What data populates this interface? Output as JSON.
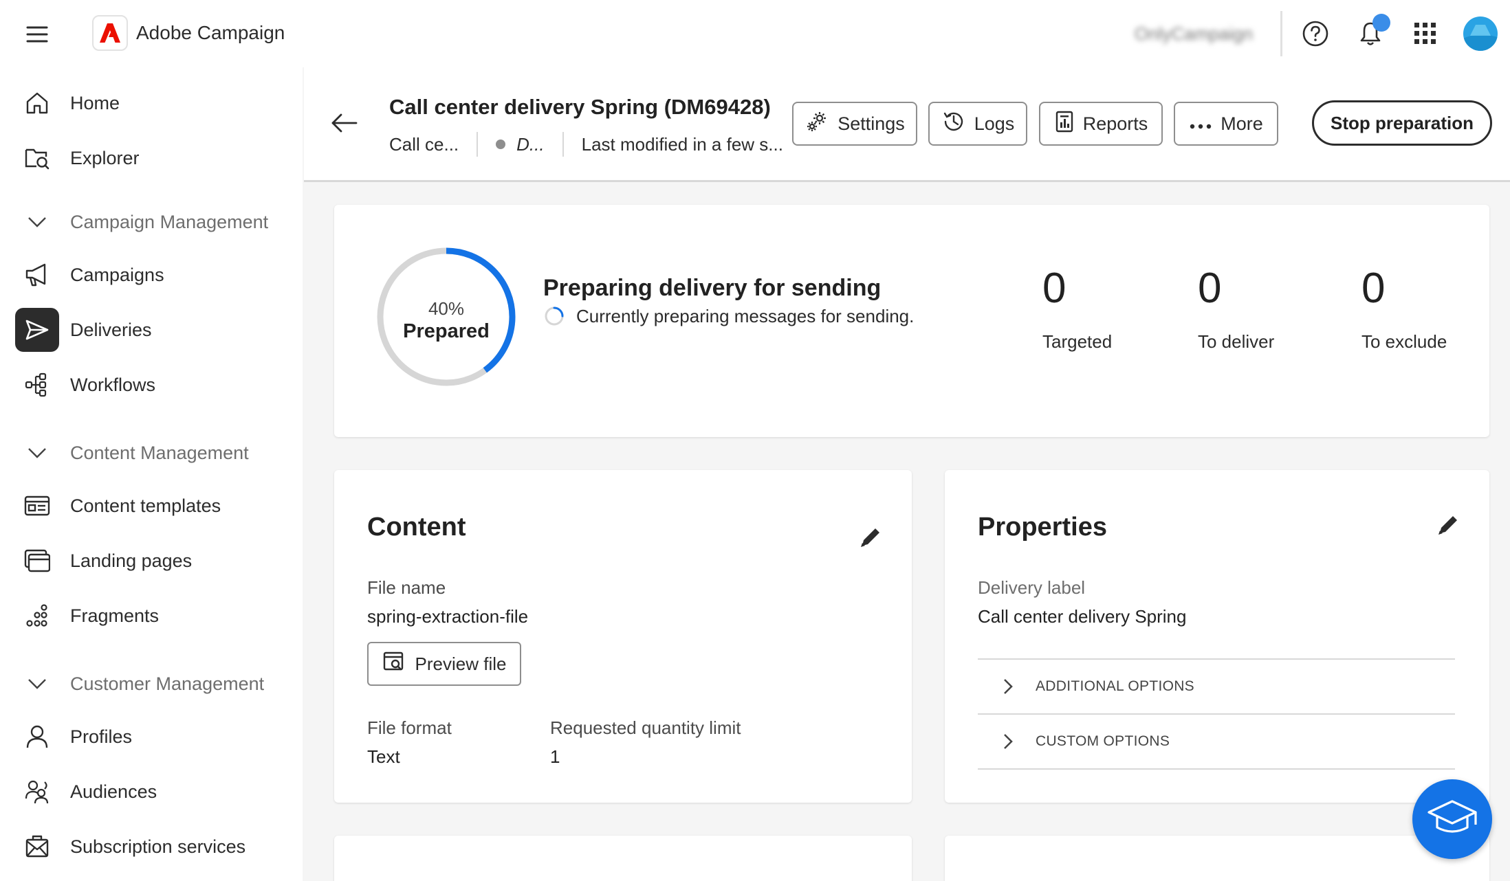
{
  "app": {
    "name": "Adobe Campaign",
    "org": "OnlyCampaign",
    "brand_color": "#eb1000",
    "accent_color": "#1473e6"
  },
  "topbar_icons": [
    "menu-icon",
    "help-icon",
    "bell-icon",
    "app-grid-icon",
    "avatar"
  ],
  "sidebar": {
    "items": [
      {
        "label": "Home",
        "icon": "home-icon"
      },
      {
        "label": "Explorer",
        "icon": "folder-search-icon"
      },
      {
        "label": "Campaigns",
        "icon": "megaphone-icon"
      },
      {
        "label": "Deliveries",
        "icon": "send-icon",
        "active": true
      },
      {
        "label": "Workflows",
        "icon": "workflow-icon"
      },
      {
        "label": "Content templates",
        "icon": "template-icon"
      },
      {
        "label": "Landing pages",
        "icon": "landing-page-icon"
      },
      {
        "label": "Fragments",
        "icon": "fragments-icon"
      },
      {
        "label": "Profiles",
        "icon": "user-icon"
      },
      {
        "label": "Audiences",
        "icon": "audiences-icon"
      },
      {
        "label": "Subscription services",
        "icon": "subscription-icon"
      }
    ],
    "sections": [
      {
        "label": "Campaign Management"
      },
      {
        "label": "Content Management"
      },
      {
        "label": "Customer Management"
      }
    ]
  },
  "header": {
    "title": "Call center delivery Spring (DM69428)",
    "meta_channel": "Call ce...",
    "meta_status": "D...",
    "meta_modified": "Last modified in a few s...",
    "buttons": {
      "settings": "Settings",
      "logs": "Logs",
      "reports": "Reports",
      "more": "More",
      "stop": "Stop preparation"
    }
  },
  "status": {
    "percent_text": "40%",
    "progress": 0.4,
    "ring_label": "Prepared",
    "title": "Preparing delivery for sending",
    "subtitle": "Currently preparing messages for sending.",
    "stats": [
      {
        "value": "0",
        "label": "Targeted"
      },
      {
        "value": "0",
        "label": "To deliver"
      },
      {
        "value": "0",
        "label": "To exclude"
      }
    ]
  },
  "content": {
    "title": "Content",
    "file_name_label": "File name",
    "file_name": "spring-extraction-file",
    "preview_button": "Preview file",
    "file_format_label": "File format",
    "file_format": "Text",
    "quantity_label": "Requested quantity limit",
    "quantity": "1"
  },
  "properties": {
    "title": "Properties",
    "delivery_label_label": "Delivery label",
    "delivery_label": "Call center delivery Spring",
    "options": [
      "ADDITIONAL OPTIONS",
      "CUSTOM OPTIONS"
    ]
  }
}
